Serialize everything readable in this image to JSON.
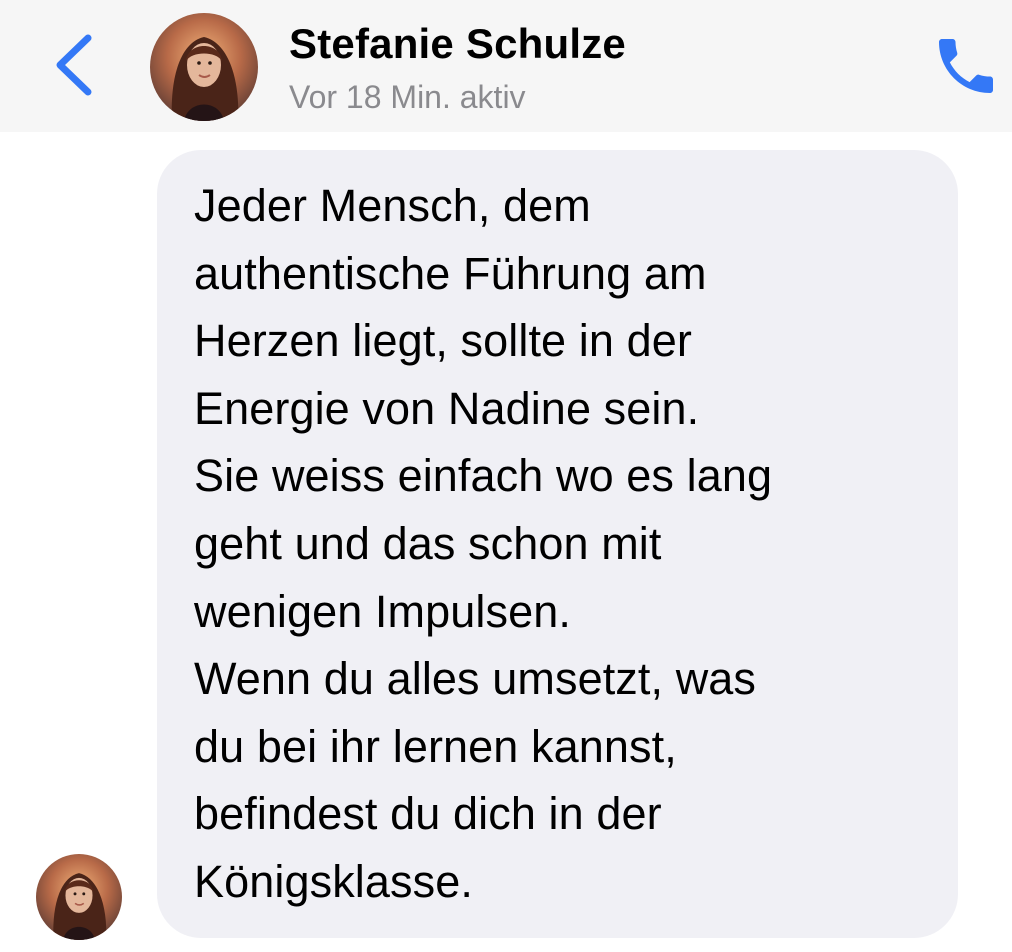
{
  "header": {
    "contact_name": "Stefanie Schulze",
    "status": "Vor 18 Min. aktiv",
    "back_icon": "chevron-left-icon",
    "call_icon": "phone-icon",
    "accent_color": "#3478f6"
  },
  "messages": [
    {
      "sender": "Stefanie Schulze",
      "text": "Jeder Mensch, dem\nauthentische Führung am\nHerzen liegt, sollte in der\nEnergie von Nadine sein.\nSie weiss einfach wo es lang\ngeht und das schon mit\nwenigen Impulsen.\nWenn du alles umsetzt, was\ndu bei ihr lernen kannst,\nbefindest du dich in der\nKönigsklasse.",
      "bubble_color": "#f0f0f5"
    }
  ]
}
